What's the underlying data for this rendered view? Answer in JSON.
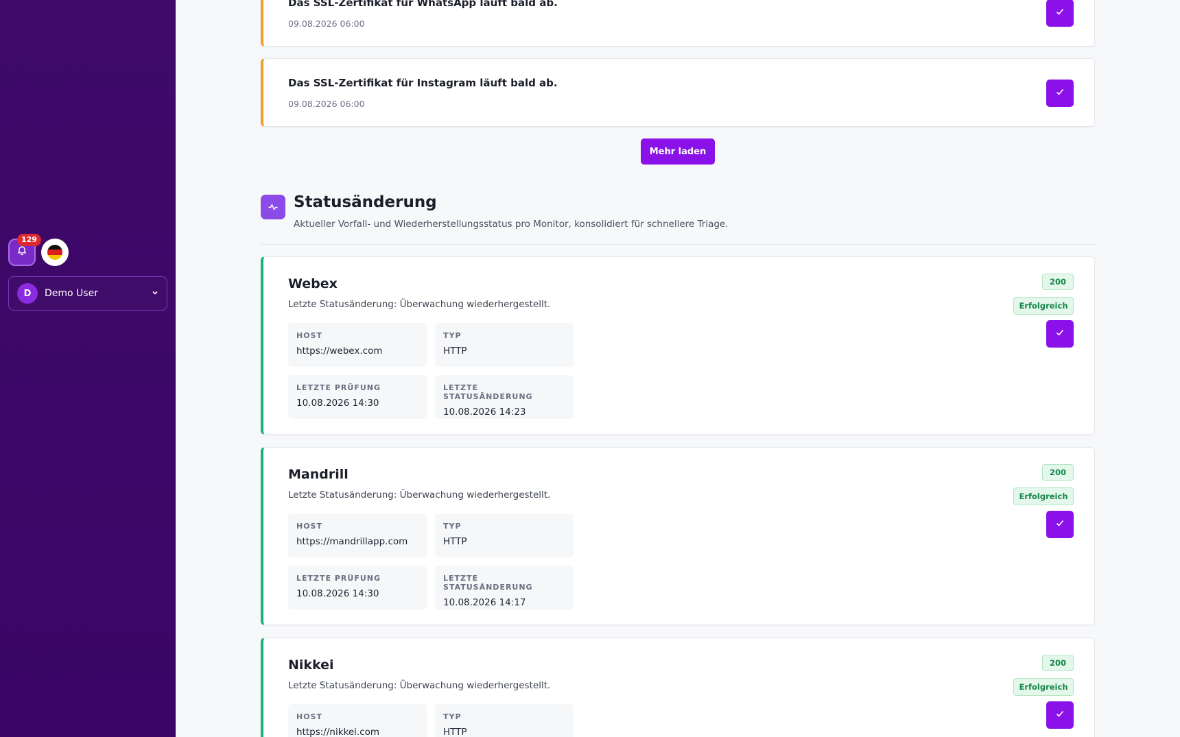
{
  "sidebar": {
    "notification_count": "129",
    "user": {
      "initial": "D",
      "name": "Demo User"
    }
  },
  "alerts": [
    {
      "title": "Das SSL-Zertifikat für WhatsApp läuft bald ab.",
      "time": "09.08.2026 06:00"
    },
    {
      "title": "Das SSL-Zertifikat für Instagram läuft bald ab.",
      "time": "09.08.2026 06:00"
    }
  ],
  "load_more_label": "Mehr laden",
  "section": {
    "title": "Statusänderung",
    "subtitle": "Aktueller Vorfall- und Wiederherstellungsstatus pro Monitor, konsolidiert für schnellere Triage."
  },
  "labels": {
    "host": "Host",
    "type": "Typ",
    "last_check": "Letzte Prüfung",
    "last_change": "Letzte Statusänderung"
  },
  "monitors": [
    {
      "name": "Webex",
      "description": "Letzte Statusänderung: Überwachung wiederhergestellt.",
      "host": "https://webex.com",
      "type": "HTTP",
      "last_check": "10.08.2026 14:30",
      "last_change": "10.08.2026 14:23",
      "code": "200",
      "status": "Erfolgreich"
    },
    {
      "name": "Mandrill",
      "description": "Letzte Statusänderung: Überwachung wiederhergestellt.",
      "host": "https://mandrillapp.com",
      "type": "HTTP",
      "last_check": "10.08.2026 14:30",
      "last_change": "10.08.2026 14:17",
      "code": "200",
      "status": "Erfolgreich"
    },
    {
      "name": "Nikkei",
      "description": "Letzte Statusänderung: Überwachung wiederhergestellt.",
      "host": "https://nikkei.com",
      "type": "HTTP",
      "last_check": "",
      "last_change": "",
      "code": "200",
      "status": "Erfolgreich"
    }
  ],
  "colors": {
    "sidebar_bg": "#3f0a6a",
    "accent": "#8a12e8",
    "warning_border": "#f0a020",
    "success_border": "#10b67a",
    "badge_red": "#e0282f"
  }
}
